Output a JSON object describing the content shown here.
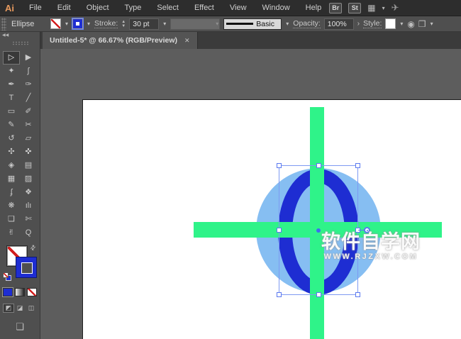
{
  "menubar": {
    "logo": "Ai",
    "items": [
      "File",
      "Edit",
      "Object",
      "Type",
      "Select",
      "Effect",
      "View",
      "Window",
      "Help"
    ],
    "right": {
      "brushes_button": "Br",
      "styles_button": "St",
      "workspace_icon": "▦",
      "workspace_chevron": "▾",
      "sync_icon": "✈"
    }
  },
  "controlbar": {
    "tool_name": "Ellipse",
    "fill_chevron": "▾",
    "stroke_chevron": "▾",
    "stroke_label": "Stroke:",
    "stroke_stepper_up": "▲",
    "stroke_stepper_down": "▼",
    "stroke_value": "30 pt",
    "stroke_value_chevron": "▾",
    "variable_width_chevron": "▾",
    "brush_name": "Basic",
    "brush_chevron": "▾",
    "opacity_label": "Opacity:",
    "opacity_value": "100%",
    "opacity_more": "›",
    "style_label": "Style:",
    "style_chevron": "▾",
    "globe_icon": "◉",
    "document_icon": "❒",
    "document_chevron": "▾"
  },
  "tabstrip": {
    "collapse_glyph": "◀◀",
    "doc_tab_title": "Untitled-5* @ 66.67% (RGB/Preview)",
    "close_glyph": "✕"
  },
  "toolbar": {
    "tools": [
      {
        "name": "selection-tool",
        "glyph": "▷",
        "selected": true
      },
      {
        "name": "direct-selection-tool",
        "glyph": "▶",
        "selected": false
      },
      {
        "name": "magic-wand-tool",
        "glyph": "✦",
        "selected": false
      },
      {
        "name": "lasso-tool",
        "glyph": "ʃ",
        "selected": false
      },
      {
        "name": "pen-tool",
        "glyph": "✒",
        "selected": false
      },
      {
        "name": "curvature-tool",
        "glyph": "✑",
        "selected": false
      },
      {
        "name": "type-tool",
        "glyph": "T",
        "selected": false
      },
      {
        "name": "line-segment-tool",
        "glyph": "╱",
        "selected": false
      },
      {
        "name": "rectangle-tool",
        "glyph": "▭",
        "selected": false
      },
      {
        "name": "paintbrush-tool",
        "glyph": "✐",
        "selected": false
      },
      {
        "name": "shaper-tool",
        "glyph": "✎",
        "selected": false
      },
      {
        "name": "scissors-tool",
        "glyph": "✂",
        "selected": false
      },
      {
        "name": "rotate-tool",
        "glyph": "↺",
        "selected": false
      },
      {
        "name": "scale-tool",
        "glyph": "▱",
        "selected": false
      },
      {
        "name": "width-tool",
        "glyph": "✣",
        "selected": false
      },
      {
        "name": "puppet-warp-tool",
        "glyph": "✜",
        "selected": false
      },
      {
        "name": "shape-builder-tool",
        "glyph": "◈",
        "selected": false
      },
      {
        "name": "perspective-grid-tool",
        "glyph": "▤",
        "selected": false
      },
      {
        "name": "mesh-tool",
        "glyph": "▦",
        "selected": false
      },
      {
        "name": "gradient-tool",
        "glyph": "▨",
        "selected": false
      },
      {
        "name": "eyedropper-tool",
        "glyph": "ʄ",
        "selected": false
      },
      {
        "name": "blend-tool",
        "glyph": "❖",
        "selected": false
      },
      {
        "name": "symbol-sprayer-tool",
        "glyph": "❋",
        "selected": false
      },
      {
        "name": "column-graph-tool",
        "glyph": "ılı",
        "selected": false
      },
      {
        "name": "artboard-tool",
        "glyph": "❏",
        "selected": false
      },
      {
        "name": "slice-tool",
        "glyph": "✄",
        "selected": false
      },
      {
        "name": "hand-tool",
        "glyph": "✌",
        "selected": false
      },
      {
        "name": "zoom-tool",
        "glyph": "Q",
        "selected": false
      }
    ],
    "swap_glyph": "⇄",
    "modes": [
      {
        "name": "draw-normal-mode",
        "glyph": "◩",
        "selected": true
      },
      {
        "name": "draw-behind-mode",
        "glyph": "◪",
        "selected": false
      },
      {
        "name": "draw-inside-mode",
        "glyph": "◫",
        "selected": false
      }
    ],
    "screen_mode_glyph": "❏"
  },
  "canvas": {
    "colors": {
      "green": "#2ff389",
      "light_blue": "#86bef2",
      "dark_blue": "#1e2dd2",
      "selection": "#5a78f0",
      "artboard": "#ffffff"
    },
    "watermark": {
      "line1": "软件自学网",
      "line2": "WWW.RJZXW.COM"
    }
  }
}
